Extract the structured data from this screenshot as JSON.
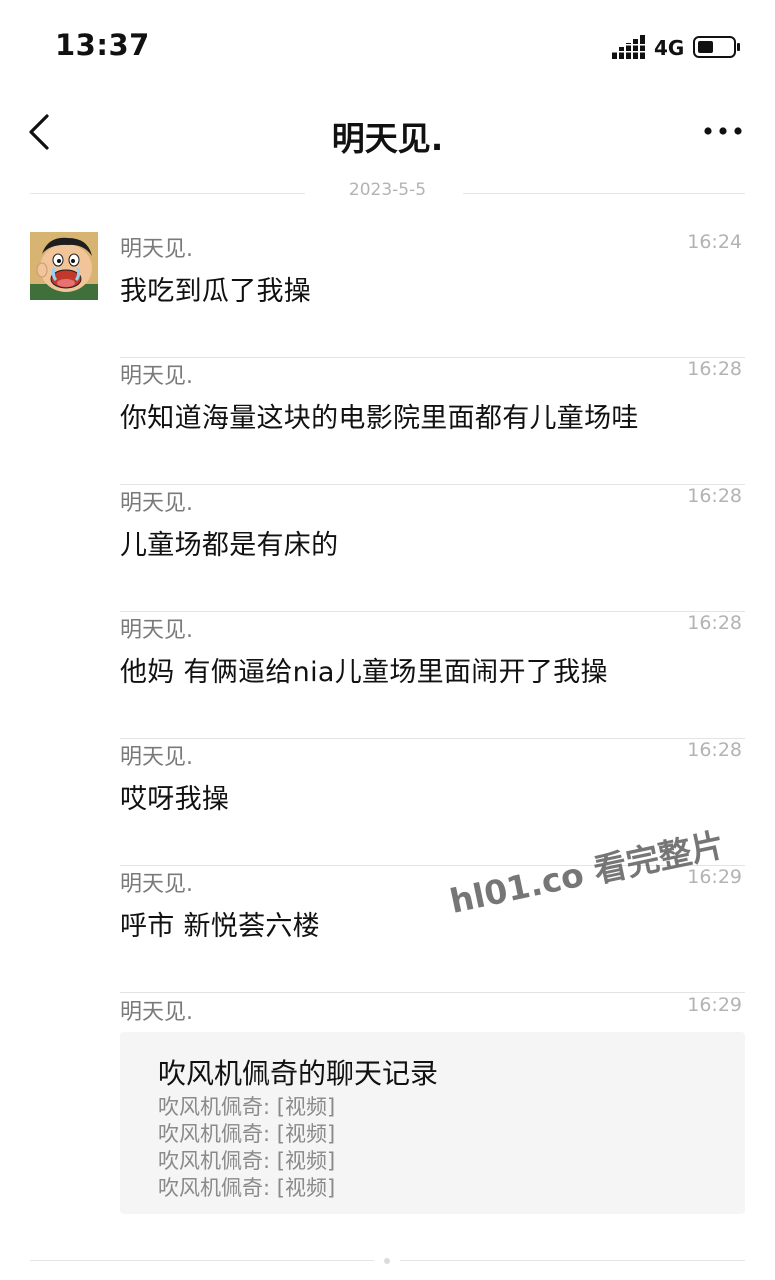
{
  "status_bar": {
    "time": "13:37",
    "network": "4G",
    "icons": [
      "signal-icon",
      "battery-icon"
    ]
  },
  "nav": {
    "title": "明天见.",
    "icons": [
      "back-chevron-icon",
      "more-dots-icon"
    ]
  },
  "date_separator": "2023-5-5",
  "avatar": {
    "icon": "cartoon-avatar-icon"
  },
  "messages": [
    {
      "name": "明天见.",
      "time": "16:24",
      "text": "我吃到瓜了我操"
    },
    {
      "name": "明天见.",
      "time": "16:28",
      "text": "你知道海量这块的电影院里面都有儿童场哇"
    },
    {
      "name": "明天见.",
      "time": "16:28",
      "text": "儿童场都是有床的"
    },
    {
      "name": "明天见.",
      "time": "16:28",
      "text": "他妈 有俩逼给nia儿童场里面闹开了我操"
    },
    {
      "name": "明天见.",
      "time": "16:28",
      "text": "哎呀我操"
    },
    {
      "name": "明天见.",
      "time": "16:29",
      "text": "呼市 新悦荟六楼"
    },
    {
      "name": "明天见.",
      "time": "16:29"
    }
  ],
  "chat_record_card": {
    "title": "吹风机佩奇的聊天记录",
    "lines": [
      "吹风机佩奇: [视频]",
      "吹风机佩奇: [视频]",
      "吹风机佩奇: [视频]",
      "吹风机佩奇: [视频]"
    ]
  },
  "watermark": "hl01.co 看完整片",
  "colors": {
    "background": "#ffffff",
    "name_gray": "#7a7a7a",
    "time_gray": "#b3b3b3",
    "card_bg": "#f5f5f5"
  }
}
